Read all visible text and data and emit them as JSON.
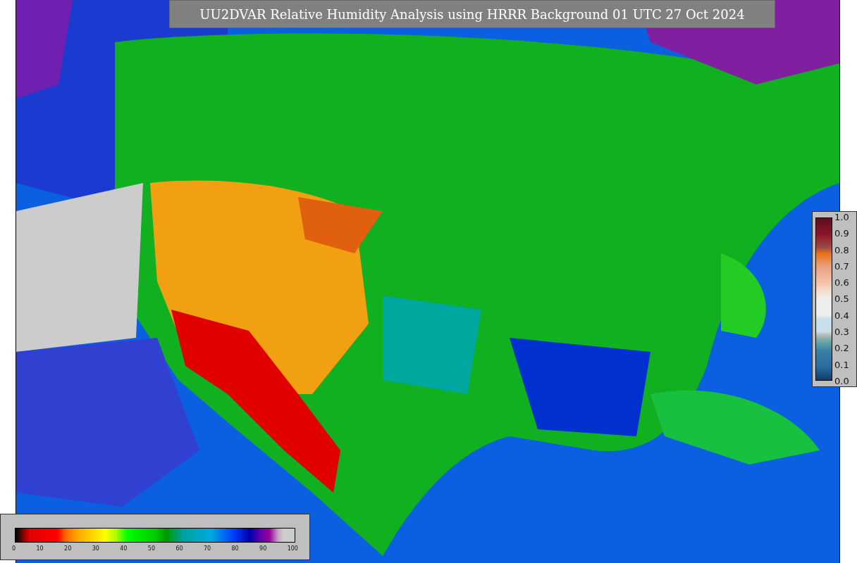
{
  "title": "UU2DVAR Relative Humidity Analysis using HRRR Background 01 UTC 27 Oct 2024",
  "ratio_scale": {
    "ticks": [
      "1.0",
      "0.9",
      "0.8",
      "0.7",
      "0.6",
      "0.5",
      "0.4",
      "0.3",
      "0.2",
      "0.1",
      "0.0"
    ]
  },
  "humidity_scale": {
    "ticks": [
      "0",
      "10",
      "20",
      "30",
      "40",
      "50",
      "60",
      "70",
      "80",
      "90",
      "100"
    ]
  }
}
